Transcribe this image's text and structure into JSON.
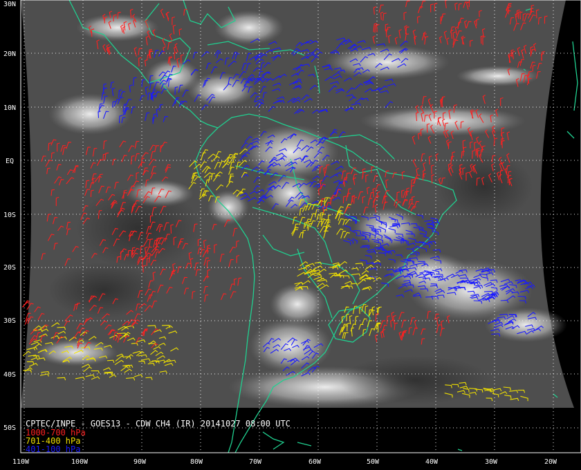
{
  "title": "CPTEC/INPE - GOES13 - CDW CH4 (IR) 20141027 08:00 UTC",
  "legend": [
    {
      "label": "1000-700 hPa",
      "color": "#ff2020"
    },
    {
      "label": "701-400 hPa",
      "color": "#f0e000"
    },
    {
      "label": "401-100 hPa",
      "color": "#1a1aff"
    }
  ],
  "latitude_labels": [
    "30N",
    "20N",
    "10N",
    "EQ",
    "10S",
    "20S",
    "30S",
    "40S",
    "50S"
  ],
  "longitude_labels": [
    "110W",
    "100W",
    "90W",
    "80W",
    "70W",
    "60W",
    "50W",
    "40W",
    "30W",
    "20W"
  ],
  "colors": {
    "coastline": "#20d090",
    "grid": "#ffffff",
    "background": "#000000",
    "imagery": "#505050"
  }
}
